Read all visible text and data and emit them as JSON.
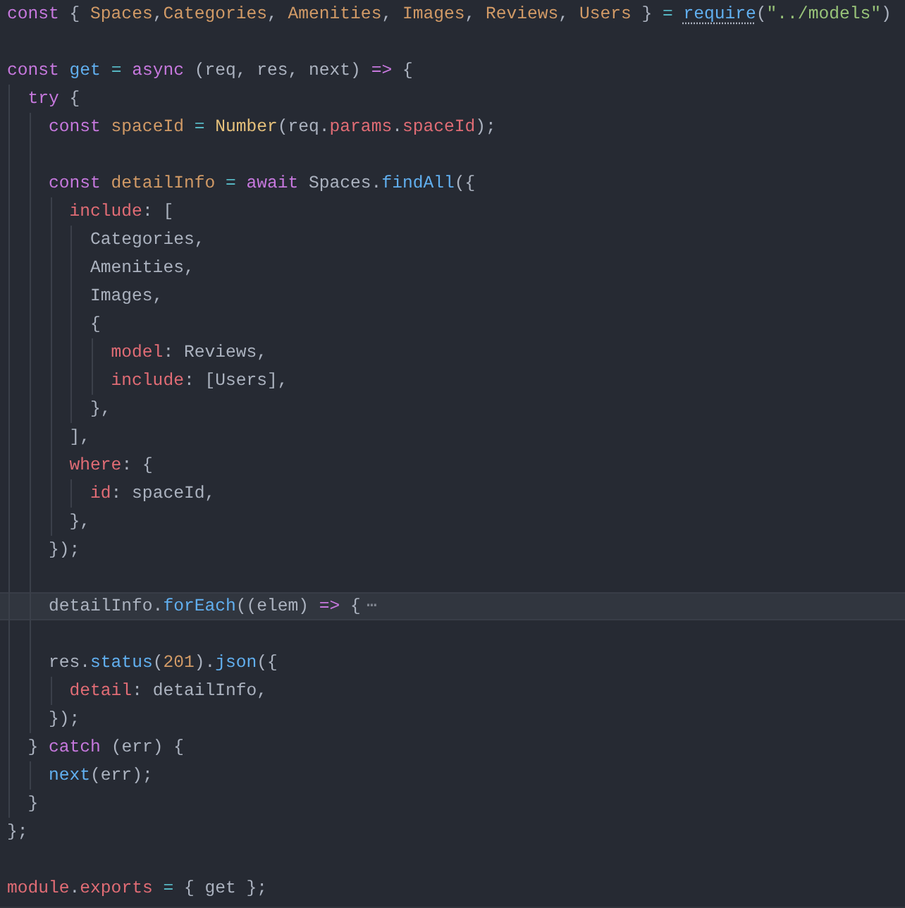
{
  "editor": {
    "lines": [
      {
        "kind": "code",
        "current": false,
        "tokens": [
          {
            "t": "const ",
            "kind": "kw"
          },
          {
            "t": "{ ",
            "kind": "p"
          },
          {
            "t": "Spaces",
            "kind": "v"
          },
          {
            "t": ",",
            "kind": "p"
          },
          {
            "t": "Categories",
            "kind": "v"
          },
          {
            "t": ", ",
            "kind": "p"
          },
          {
            "t": "Amenities",
            "kind": "v"
          },
          {
            "t": ", ",
            "kind": "p"
          },
          {
            "t": "Images",
            "kind": "v"
          },
          {
            "t": ", ",
            "kind": "p"
          },
          {
            "t": "Reviews",
            "kind": "v"
          },
          {
            "t": ", ",
            "kind": "p"
          },
          {
            "t": "Users",
            "kind": "v"
          },
          {
            "t": " } ",
            "kind": "p"
          },
          {
            "t": "= ",
            "kind": "op"
          },
          {
            "t": "require",
            "kind": "hint"
          },
          {
            "t": "(",
            "kind": "p"
          },
          {
            "t": "\"../models\"",
            "kind": "str"
          },
          {
            "t": ")",
            "kind": "p"
          }
        ]
      },
      {
        "kind": "blank"
      },
      {
        "kind": "code",
        "current": false,
        "tokens": [
          {
            "t": "const ",
            "kind": "kw"
          },
          {
            "t": "get ",
            "kind": "fn"
          },
          {
            "t": "= ",
            "kind": "op"
          },
          {
            "t": "async ",
            "kind": "kw"
          },
          {
            "t": "(req, res, next) ",
            "kind": "p"
          },
          {
            "t": "=>",
            "kind": "kw"
          },
          {
            "t": " {",
            "kind": "p"
          }
        ]
      },
      {
        "kind": "code",
        "current": false,
        "tokens": [
          {
            "t": "  try",
            "kind": "kw"
          },
          {
            "t": " {",
            "kind": "p"
          }
        ]
      },
      {
        "kind": "code",
        "current": false,
        "tokens": [
          {
            "t": "    const ",
            "kind": "kw"
          },
          {
            "t": "spaceId ",
            "kind": "v"
          },
          {
            "t": "= ",
            "kind": "op"
          },
          {
            "t": "Number",
            "kind": "cls"
          },
          {
            "t": "(req.",
            "kind": "p"
          },
          {
            "t": "params",
            "kind": "prop"
          },
          {
            "t": ".",
            "kind": "p"
          },
          {
            "t": "spaceId",
            "kind": "prop"
          },
          {
            "t": ");",
            "kind": "p"
          }
        ]
      },
      {
        "kind": "blank"
      },
      {
        "kind": "code",
        "current": false,
        "tokens": [
          {
            "t": "    const ",
            "kind": "kw"
          },
          {
            "t": "detailInfo ",
            "kind": "v"
          },
          {
            "t": "= ",
            "kind": "op"
          },
          {
            "t": "await",
            "kind": "kw"
          },
          {
            "t": " Spaces.",
            "kind": "p"
          },
          {
            "t": "findAll",
            "kind": "fn"
          },
          {
            "t": "({",
            "kind": "p"
          }
        ]
      },
      {
        "kind": "code",
        "current": false,
        "tokens": [
          {
            "t": "      include",
            "kind": "prop"
          },
          {
            "t": ": [",
            "kind": "p"
          }
        ]
      },
      {
        "kind": "code",
        "current": false,
        "tokens": [
          {
            "t": "        Categories,",
            "kind": "p"
          }
        ]
      },
      {
        "kind": "code",
        "current": false,
        "tokens": [
          {
            "t": "        Amenities,",
            "kind": "p"
          }
        ]
      },
      {
        "kind": "code",
        "current": false,
        "tokens": [
          {
            "t": "        Images,",
            "kind": "p"
          }
        ]
      },
      {
        "kind": "code",
        "current": false,
        "tokens": [
          {
            "t": "        {",
            "kind": "p"
          }
        ]
      },
      {
        "kind": "code",
        "current": false,
        "tokens": [
          {
            "t": "          model",
            "kind": "prop"
          },
          {
            "t": ": Reviews,",
            "kind": "p"
          }
        ]
      },
      {
        "kind": "code",
        "current": false,
        "tokens": [
          {
            "t": "          include",
            "kind": "prop"
          },
          {
            "t": ": [Users],",
            "kind": "p"
          }
        ]
      },
      {
        "kind": "code",
        "current": false,
        "tokens": [
          {
            "t": "        },",
            "kind": "p"
          }
        ]
      },
      {
        "kind": "code",
        "current": false,
        "tokens": [
          {
            "t": "      ],",
            "kind": "p"
          }
        ]
      },
      {
        "kind": "code",
        "current": false,
        "tokens": [
          {
            "t": "      where",
            "kind": "prop"
          },
          {
            "t": ": {",
            "kind": "p"
          }
        ]
      },
      {
        "kind": "code",
        "current": false,
        "tokens": [
          {
            "t": "        id",
            "kind": "prop"
          },
          {
            "t": ": spaceId,",
            "kind": "p"
          }
        ]
      },
      {
        "kind": "code",
        "current": false,
        "tokens": [
          {
            "t": "      },",
            "kind": "p"
          }
        ]
      },
      {
        "kind": "code",
        "current": false,
        "tokens": [
          {
            "t": "    });",
            "kind": "p"
          }
        ]
      },
      {
        "kind": "blank"
      },
      {
        "kind": "code",
        "current": true,
        "tokens": [
          {
            "t": "    detailInfo.",
            "kind": "p"
          },
          {
            "t": "forEach",
            "kind": "fn"
          },
          {
            "t": "((elem) ",
            "kind": "p"
          },
          {
            "t": "=>",
            "kind": "kw"
          },
          {
            "t": " {",
            "kind": "p"
          },
          {
            "t": "⋯",
            "kind": "fold"
          }
        ]
      },
      {
        "kind": "blank"
      },
      {
        "kind": "code",
        "current": false,
        "tokens": [
          {
            "t": "    res.",
            "kind": "p"
          },
          {
            "t": "status",
            "kind": "fn"
          },
          {
            "t": "(",
            "kind": "p"
          },
          {
            "t": "201",
            "kind": "num"
          },
          {
            "t": ").",
            "kind": "p"
          },
          {
            "t": "json",
            "kind": "fn"
          },
          {
            "t": "({",
            "kind": "p"
          }
        ]
      },
      {
        "kind": "code",
        "current": false,
        "tokens": [
          {
            "t": "      detail",
            "kind": "prop"
          },
          {
            "t": ": detailInfo,",
            "kind": "p"
          }
        ]
      },
      {
        "kind": "code",
        "current": false,
        "tokens": [
          {
            "t": "    });",
            "kind": "p"
          }
        ]
      },
      {
        "kind": "code",
        "current": false,
        "tokens": [
          {
            "t": "  } ",
            "kind": "p"
          },
          {
            "t": "catch",
            "kind": "kw"
          },
          {
            "t": " (err) {",
            "kind": "p"
          }
        ]
      },
      {
        "kind": "code",
        "current": false,
        "tokens": [
          {
            "t": "    next",
            "kind": "fn"
          },
          {
            "t": "(err);",
            "kind": "p"
          }
        ]
      },
      {
        "kind": "code",
        "current": false,
        "tokens": [
          {
            "t": "  }",
            "kind": "p"
          }
        ]
      },
      {
        "kind": "code",
        "current": false,
        "tokens": [
          {
            "t": "};",
            "kind": "p"
          }
        ]
      },
      {
        "kind": "blank"
      },
      {
        "kind": "code",
        "current": false,
        "tokens": [
          {
            "t": "module",
            "kind": "prop"
          },
          {
            "t": ".",
            "kind": "p"
          },
          {
            "t": "exports ",
            "kind": "prop"
          },
          {
            "t": "= ",
            "kind": "op"
          },
          {
            "t": "{ get };",
            "kind": "p"
          }
        ]
      }
    ]
  }
}
